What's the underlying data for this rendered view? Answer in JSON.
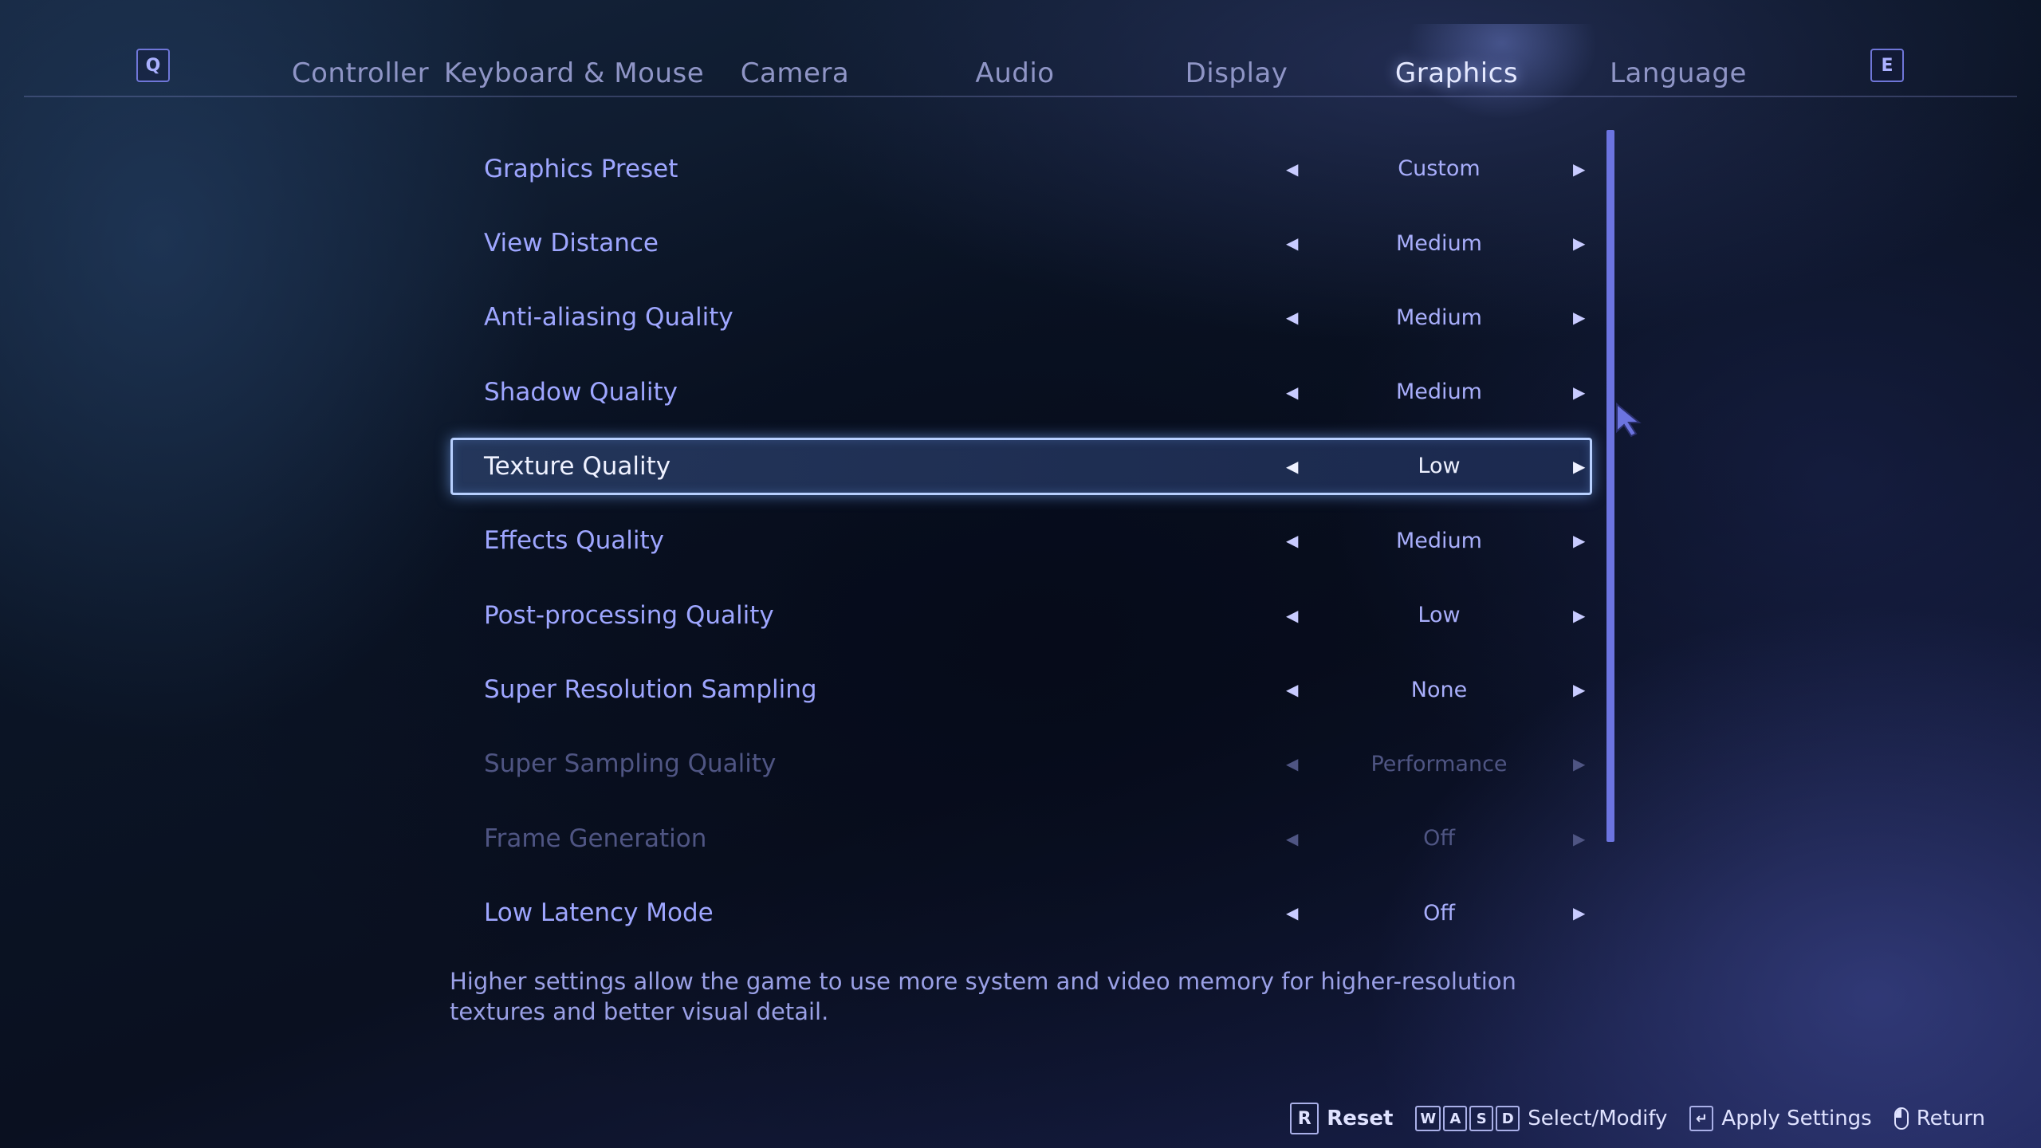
{
  "tabs": {
    "prev_key": "Q",
    "next_key": "E",
    "items": [
      {
        "label": "Controller"
      },
      {
        "label": "Keyboard & Mouse"
      },
      {
        "label": "Camera"
      },
      {
        "label": "Audio"
      },
      {
        "label": "Display"
      },
      {
        "label": "Graphics",
        "active": true
      },
      {
        "label": "Language"
      }
    ]
  },
  "settings": [
    {
      "label": "Graphics Preset",
      "value": "Custom"
    },
    {
      "label": "View Distance",
      "value": "Medium"
    },
    {
      "label": "Anti-aliasing Quality",
      "value": "Medium"
    },
    {
      "label": "Shadow Quality",
      "value": "Medium"
    },
    {
      "label": "Texture Quality",
      "value": "Low",
      "selected": true
    },
    {
      "label": "Effects Quality",
      "value": "Medium"
    },
    {
      "label": "Post-processing Quality",
      "value": "Low"
    },
    {
      "label": "Super Resolution Sampling",
      "value": "None"
    },
    {
      "label": "Super Sampling Quality",
      "value": "Performance",
      "disabled": true
    },
    {
      "label": "Frame Generation",
      "value": "Off",
      "disabled": true
    },
    {
      "label": "Low Latency Mode",
      "value": "Off"
    }
  ],
  "description": "Higher settings allow the game to use more system and video memory for higher-resolution textures and better visual detail.",
  "footer": {
    "reset_key": "R",
    "reset_label": "Reset",
    "move_keys": [
      "W",
      "A",
      "S",
      "D"
    ],
    "select_label": "Select/Modify",
    "apply_key": "↵",
    "apply_label": "Apply Settings",
    "return_label": "Return"
  },
  "icons": {
    "arrow_left": "chevron-left-icon",
    "arrow_right": "chevron-right-icon",
    "mouse": "mouse-icon",
    "cursor": "cursor-icon"
  },
  "colors": {
    "accent": "#6c74e0",
    "label": "#9ea6ff",
    "disabled": "#4f5583",
    "selected_border": "#b8d0ff"
  }
}
